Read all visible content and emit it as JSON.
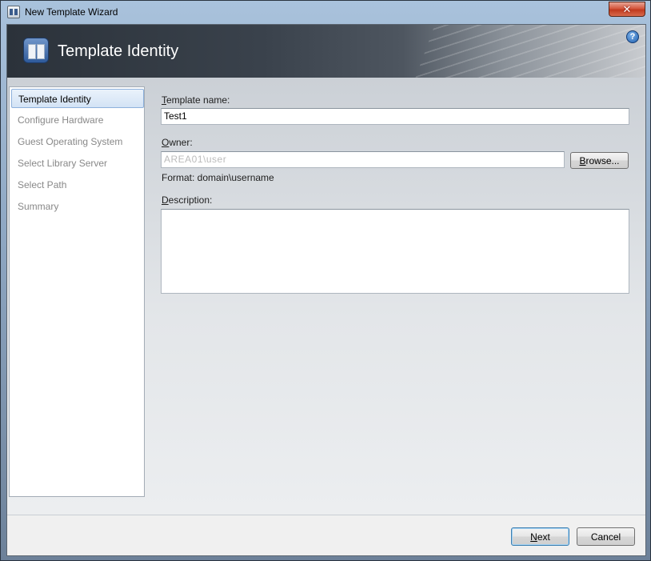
{
  "window": {
    "title": "New Template Wizard",
    "close_label": "✕"
  },
  "header": {
    "title": "Template Identity",
    "help_label": "?"
  },
  "nav": {
    "items": [
      {
        "label": "Template Identity",
        "active": true
      },
      {
        "label": "Configure Hardware",
        "active": false
      },
      {
        "label": "Guest Operating System",
        "active": false
      },
      {
        "label": "Select Library Server",
        "active": false
      },
      {
        "label": "Select Path",
        "active": false
      },
      {
        "label": "Summary",
        "active": false
      }
    ]
  },
  "form": {
    "template_name": {
      "label_first": "T",
      "label_rest": "emplate name:",
      "value": "Test1"
    },
    "owner": {
      "label_first": "O",
      "label_rest": "wner:",
      "value": "AREA01\\user",
      "hint": "Format: domain\\username"
    },
    "browse_label_first": "B",
    "browse_label_rest": "rowse...",
    "description": {
      "label_first": "D",
      "label_rest": "escription:",
      "value": ""
    }
  },
  "footer": {
    "next_first": "N",
    "next_rest": "ext",
    "cancel_label": "Cancel"
  },
  "colors": {
    "header_dark": "#2b323a",
    "nav_active_border": "#8eb1dc",
    "default_button_border": "#3c7fb1"
  }
}
